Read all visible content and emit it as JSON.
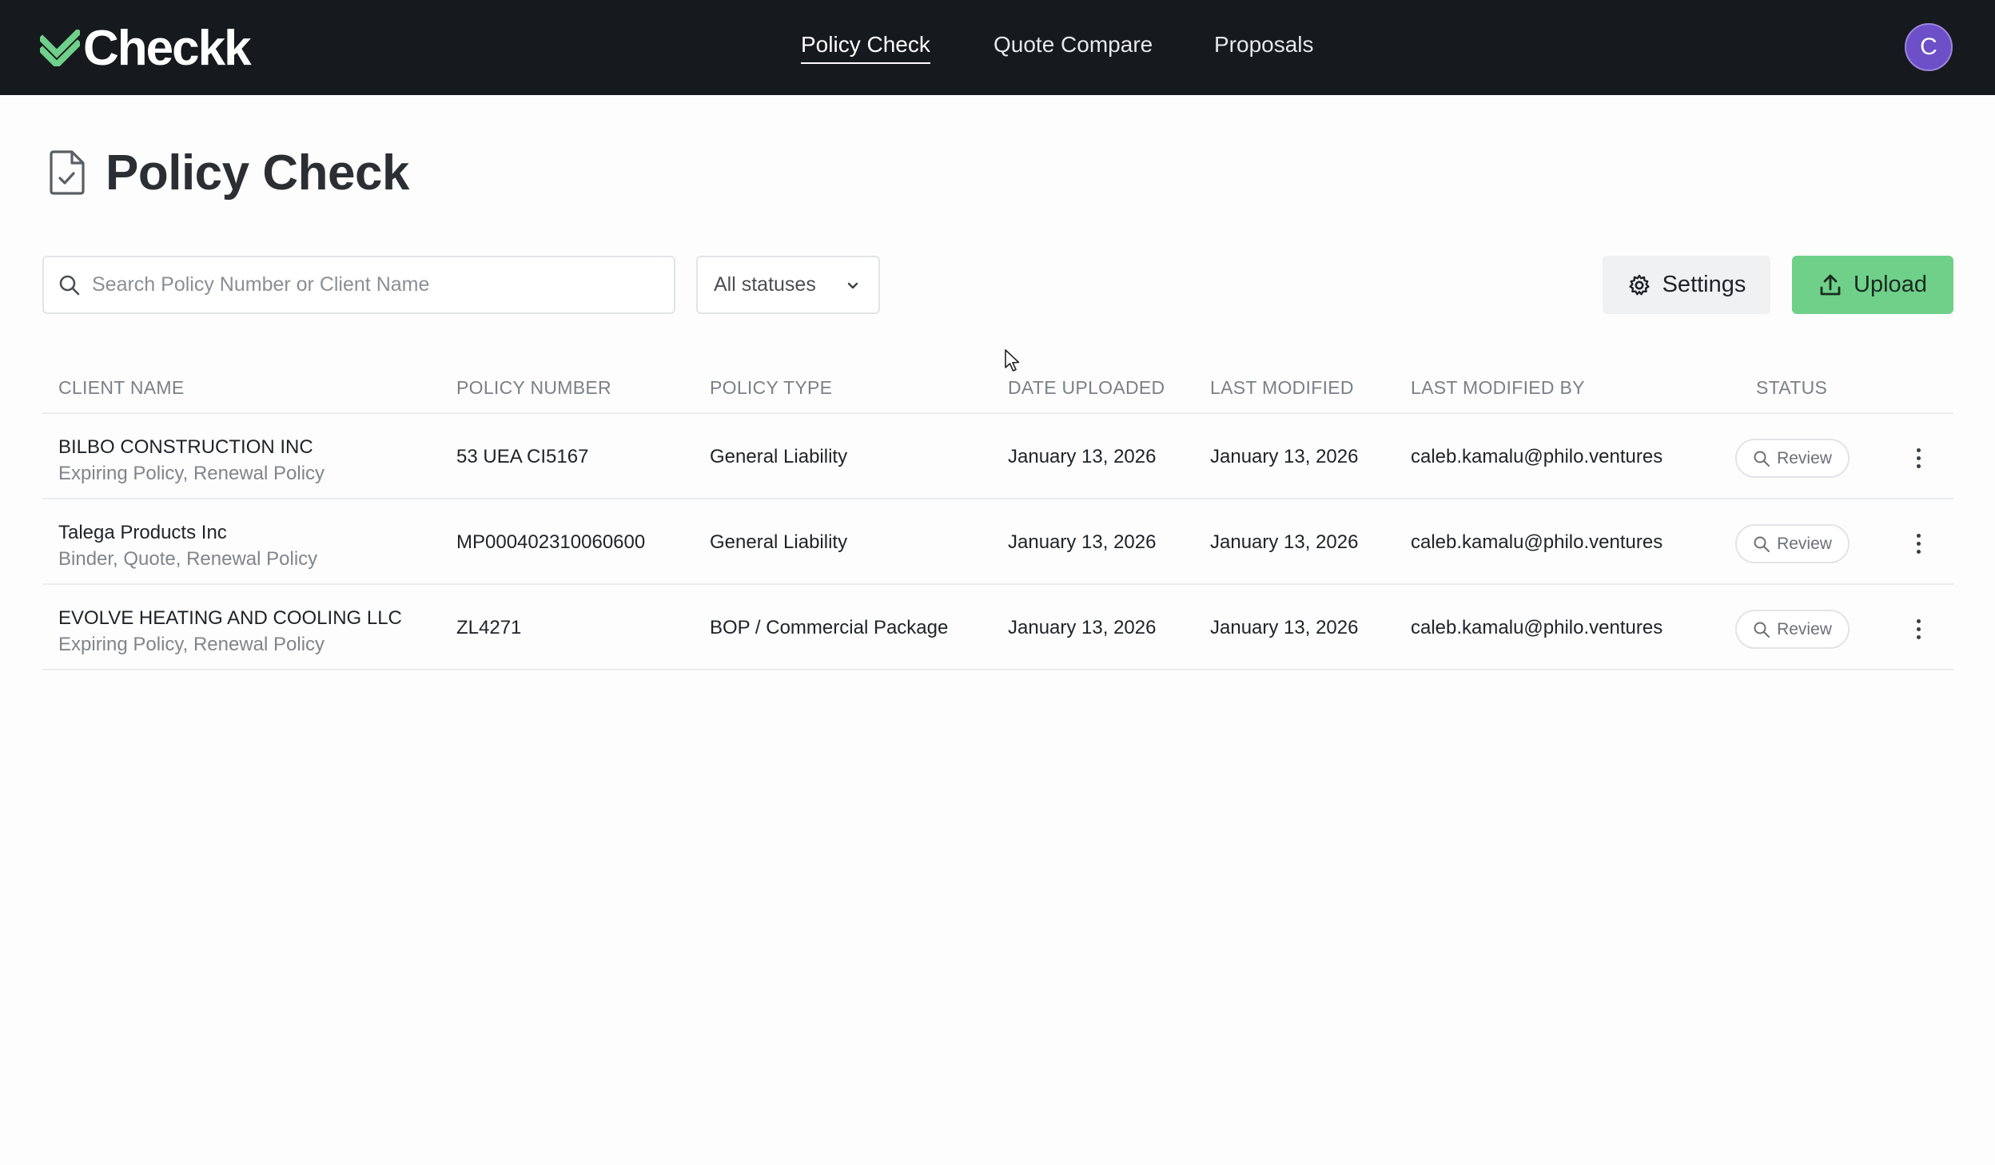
{
  "brand": {
    "name": "Checkk",
    "accent": "#6fd08a"
  },
  "nav": {
    "items": [
      {
        "label": "Policy Check",
        "active": true
      },
      {
        "label": "Quote Compare",
        "active": false
      },
      {
        "label": "Proposals",
        "active": false
      }
    ]
  },
  "user": {
    "avatar_initial": "C",
    "avatar_color": "#6d4fc7"
  },
  "page": {
    "title": "Policy Check",
    "icon": "document-check-icon"
  },
  "toolbar": {
    "search_placeholder": "Search Policy Number or Client Name",
    "search_value": "",
    "status_filter": "All statuses",
    "settings_label": "Settings",
    "upload_label": "Upload"
  },
  "table": {
    "columns": [
      "CLIENT NAME",
      "POLICY NUMBER",
      "POLICY TYPE",
      "DATE UPLOADED",
      "LAST MODIFIED",
      "LAST MODIFIED BY",
      "STATUS"
    ],
    "rows": [
      {
        "client_name": "BILBO CONSTRUCTION INC",
        "client_tags": "Expiring Policy, Renewal Policy",
        "policy_number": "53 UEA CI5167",
        "policy_type": "General Liability",
        "date_uploaded": "January 13, 2026",
        "last_modified": "January 13, 2026",
        "last_modified_by": "caleb.kamalu@philo.ventures",
        "status": "Review"
      },
      {
        "client_name": "Talega Products Inc",
        "client_tags": "Binder, Quote, Renewal Policy",
        "policy_number": "MP000402310060600",
        "policy_type": "General Liability",
        "date_uploaded": "January 13, 2026",
        "last_modified": "January 13, 2026",
        "last_modified_by": "caleb.kamalu@philo.ventures",
        "status": "Review"
      },
      {
        "client_name": "EVOLVE HEATING AND COOLING LLC",
        "client_tags": "Expiring Policy, Renewal Policy",
        "policy_number": "ZL4271",
        "policy_type": "BOP / Commercial Package",
        "date_uploaded": "January 13, 2026",
        "last_modified": "January 13, 2026",
        "last_modified_by": "caleb.kamalu@philo.ventures",
        "status": "Review"
      }
    ]
  }
}
